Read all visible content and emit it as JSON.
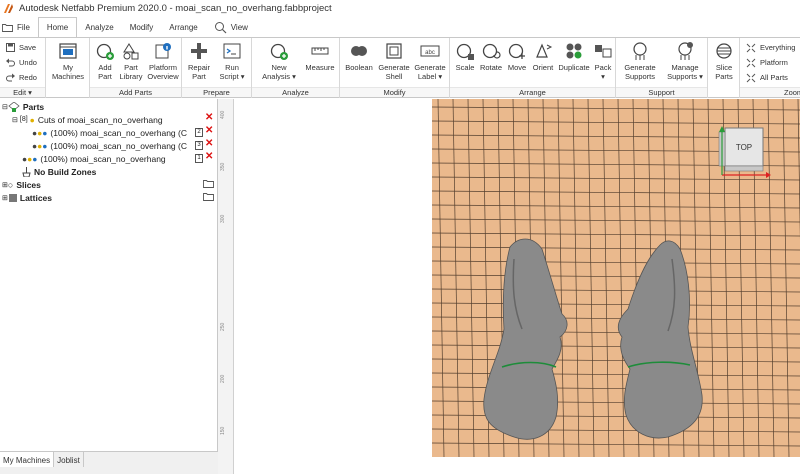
{
  "window": {
    "title": "Autodesk Netfabb Premium 2020.0 - moai_scan_no_overhang.fabbproject"
  },
  "tabs": [
    {
      "label": "File"
    },
    {
      "label": "Home"
    },
    {
      "label": "Analyze"
    },
    {
      "label": "Modify"
    },
    {
      "label": "Arrange"
    },
    {
      "label": "View"
    }
  ],
  "ribbon": {
    "edit": {
      "save": "Save",
      "undo": "Undo",
      "redo": "Redo",
      "label": "Edit ▾"
    },
    "machines": {
      "line1": "My",
      "line2": "Machines"
    },
    "add_parts": {
      "add_part": [
        "Add",
        "Part"
      ],
      "part_library": [
        "Part",
        "Library"
      ],
      "platform_overview": [
        "Platform",
        "Overview"
      ],
      "label": "Add Parts"
    },
    "prepare": {
      "repair_part": [
        "Repair",
        "Part"
      ],
      "run_script": [
        "Run",
        "Script ▾"
      ],
      "label": "Prepare"
    },
    "analyze": {
      "new_analysis": [
        "New",
        "Analysis ▾"
      ],
      "measure": "Measure",
      "label": "Analyze"
    },
    "modify": {
      "boolean": "Boolean",
      "generate_shell": [
        "Generate",
        "Shell"
      ],
      "generate_label": [
        "Generate",
        "Label ▾"
      ],
      "label": "Modify"
    },
    "arrange": {
      "scale": "Scale",
      "rotate": "Rotate",
      "move": "Move",
      "orient": "Orient",
      "duplicate": "Duplicate",
      "pack": [
        "Pack",
        "▾"
      ],
      "label": "Arrange"
    },
    "support": {
      "generate_supports": [
        "Generate",
        "Supports"
      ],
      "manage_supports": [
        "Manage",
        "Supports ▾"
      ],
      "label": "Support"
    },
    "slice": {
      "slice_parts": [
        "Slice",
        "Parts"
      ]
    },
    "zoom": {
      "everything": "Everything",
      "platform": "Platform",
      "all_parts": "All Parts",
      "label": "Zoom"
    }
  },
  "tree": {
    "parts": "Parts",
    "cuts": "Cuts of moai_scan_no_overhang",
    "cut_item_1": "(100%) moai_scan_no_overhang (C",
    "cut_item_2": "(100%) moai_scan_no_overhang (C",
    "cut_item_1_num": "2",
    "cut_item_2_num": "3",
    "part_item": "(100%) moai_scan_no_overhang",
    "part_item_num": "1",
    "no_build_zones": "No Build Zones",
    "slices": "Slices",
    "lattices": "Lattices"
  },
  "bottom_tabs": [
    {
      "label": "My Machines"
    },
    {
      "label": "Joblist"
    }
  ],
  "ruler": {
    "ticks": [
      "400",
      "350",
      "300",
      "250",
      "200",
      "150"
    ]
  },
  "viewcube": {
    "face": "TOP"
  },
  "colors": {
    "platform": "#eab98d",
    "grid": "#3a2a1e",
    "model": "#8a8a8a",
    "accent_blue": "#1f6fbf"
  }
}
